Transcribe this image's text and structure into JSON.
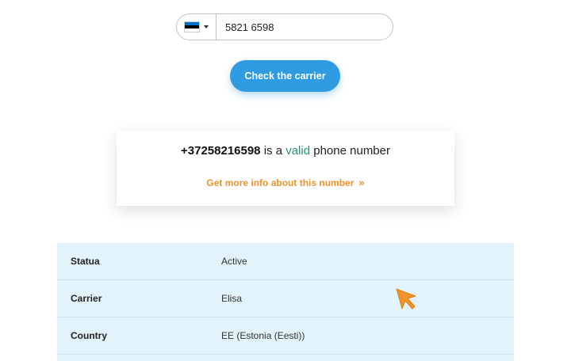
{
  "phone_form": {
    "country_flag": "estonia-flag-icon",
    "flag_colors": [
      "#0072ce",
      "#000000",
      "#ffffff"
    ],
    "phone_value": "5821 6598",
    "button_label": "Check the carrier"
  },
  "result": {
    "number": "+37258216598",
    "text_is_a": "is a",
    "status_word": "valid",
    "text_suffix": "phone number",
    "more_link": "Get more info about this number",
    "more_link_icon": "double-chevron-right-icon"
  },
  "info_table": {
    "rows": [
      {
        "label": "Statua",
        "value": "Active"
      },
      {
        "label": "Carrier",
        "value": "Elisa"
      },
      {
        "label": "Country",
        "value": "EE (Estonia (Eesti))"
      }
    ]
  },
  "colors": {
    "accent_blue": "#2f9be0",
    "valid_green": "#1d9a6c",
    "link_orange": "#f0932b",
    "table_bg": "#e3f3fc",
    "cursor_orange": "#f0932b"
  }
}
